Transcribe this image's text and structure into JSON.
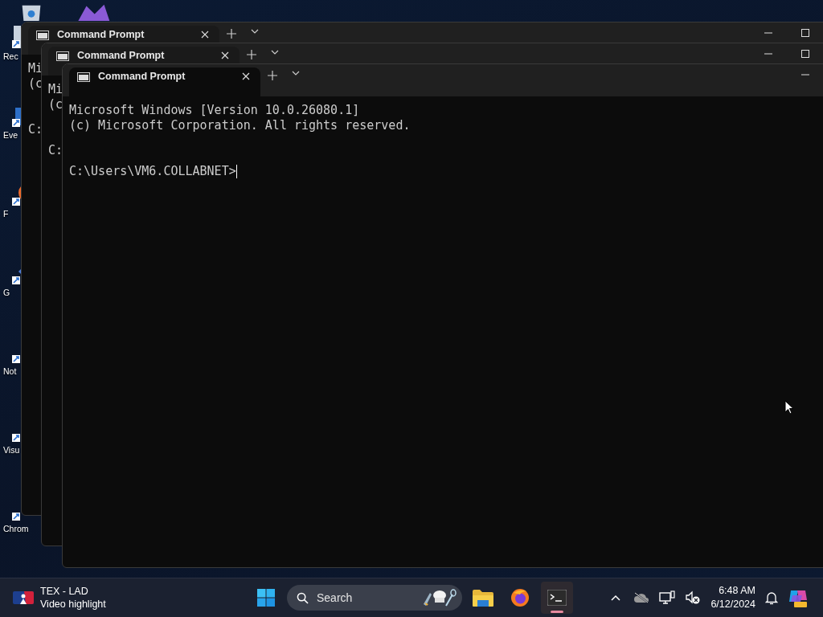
{
  "desktop_icons": [
    {
      "kind": "recycle",
      "label": "Rec"
    },
    {
      "kind": "calendar",
      "label": "Eve"
    },
    {
      "kind": "firefox",
      "label": "F"
    },
    {
      "kind": "diamond",
      "label": "G"
    },
    {
      "kind": "notepad",
      "label": "Not"
    },
    {
      "kind": "vscode",
      "label": "Visu"
    },
    {
      "kind": "chrome",
      "label": "Chrom"
    }
  ],
  "windows": [
    {
      "tab_title": "Command Prompt",
      "active": false,
      "banner": [
        "Mi",
        "(c"
      ],
      "prompt": "C:",
      "controls": [
        {
          "kind": "minimize"
        },
        {
          "kind": "maximize"
        }
      ]
    },
    {
      "tab_title": "Command Prompt",
      "active": false,
      "banner": [
        "Mi",
        "(c"
      ],
      "prompt": "C:",
      "controls": [
        {
          "kind": "minimize"
        },
        {
          "kind": "maximize"
        }
      ]
    },
    {
      "tab_title": "Command Prompt",
      "active": true,
      "banner": [
        "Microsoft Windows [Version 10.0.26080.1]",
        "(c) Microsoft Corporation. All rights reserved."
      ],
      "prompt": "C:\\Users\\VM6.COLLABNET>",
      "controls": [
        {
          "kind": "minimize"
        }
      ]
    }
  ],
  "taskbar": {
    "widget": {
      "title": "TEX - LAD",
      "subtitle": "Video highlight"
    },
    "search": {
      "placeholder": "Search"
    },
    "apps": [
      {
        "kind": "files",
        "selected": false
      },
      {
        "kind": "firefox",
        "selected": false
      },
      {
        "kind": "terminal",
        "selected": true
      }
    ],
    "tray": [
      {
        "kind": "chevron"
      },
      {
        "kind": "cloud-off"
      },
      {
        "kind": "network"
      },
      {
        "kind": "speaker-muted"
      }
    ],
    "clock": {
      "time": "6:48 AM",
      "date": "6/12/2024"
    }
  }
}
